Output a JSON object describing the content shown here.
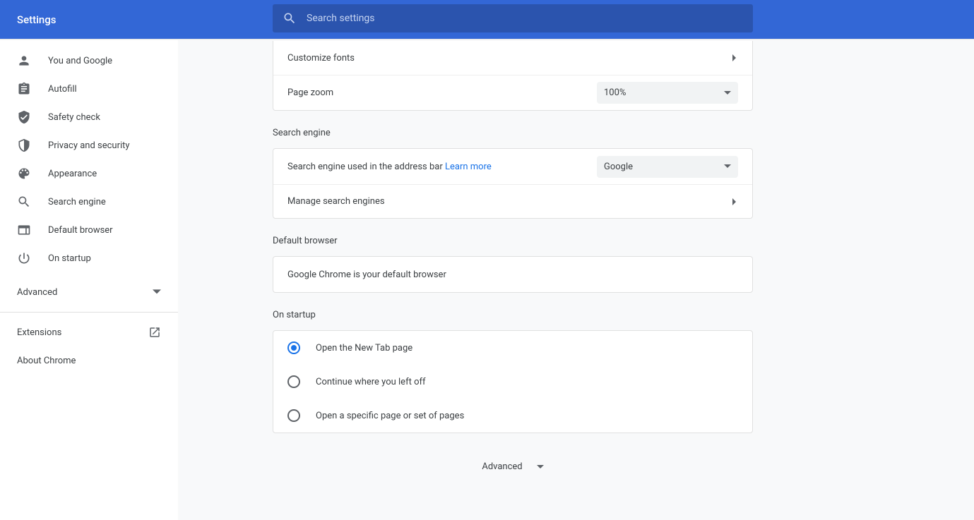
{
  "header": {
    "title": "Settings"
  },
  "search": {
    "placeholder": "Search settings"
  },
  "sidebar": {
    "items": [
      {
        "label": "You and Google",
        "icon": "person-icon"
      },
      {
        "label": "Autofill",
        "icon": "clipboard-icon"
      },
      {
        "label": "Safety check",
        "icon": "check-shield-icon"
      },
      {
        "label": "Privacy and security",
        "icon": "shield-icon"
      },
      {
        "label": "Appearance",
        "icon": "palette-icon"
      },
      {
        "label": "Search engine",
        "icon": "search-icon"
      },
      {
        "label": "Default browser",
        "icon": "browser-icon"
      },
      {
        "label": "On startup",
        "icon": "power-icon"
      }
    ],
    "advanced_label": "Advanced",
    "extensions_label": "Extensions",
    "about_label": "About Chrome"
  },
  "main": {
    "customize_fonts_label": "Customize fonts",
    "page_zoom_label": "Page zoom",
    "page_zoom_value": "100%",
    "search_engine_section": "Search engine",
    "search_engine_row_label": "Search engine used in the address bar",
    "learn_more": "Learn more",
    "search_engine_value": "Google",
    "manage_search_label": "Manage search engines",
    "default_browser_section": "Default browser",
    "default_browser_text": "Google Chrome is your default browser",
    "on_startup_section": "On startup",
    "startup_options": [
      {
        "label": "Open the New Tab page",
        "selected": true
      },
      {
        "label": "Continue where you left off",
        "selected": false
      },
      {
        "label": "Open a specific page or set of pages",
        "selected": false
      }
    ],
    "footer_advanced": "Advanced"
  }
}
